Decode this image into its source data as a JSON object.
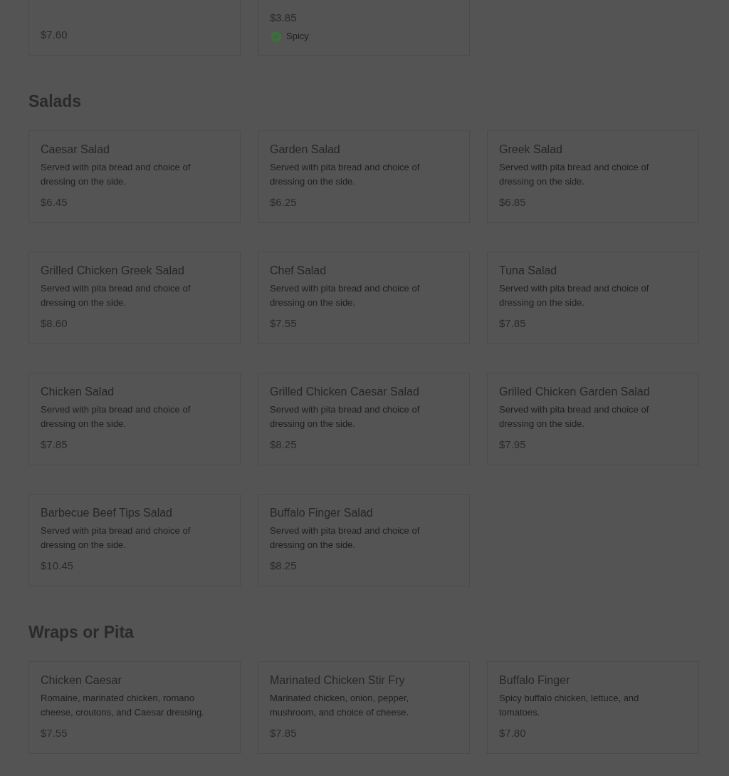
{
  "sections": [
    {
      "items": [
        {
          "price": "$7.60"
        },
        {
          "price": "$3.85",
          "tags": [
            "Spicy"
          ]
        }
      ]
    },
    {
      "heading": "Salads",
      "items": [
        {
          "name": "Caesar Salad",
          "description": "Served with pita bread and choice of dressing on the side.",
          "price": "$6.45"
        },
        {
          "name": "Garden Salad",
          "description": "Served with pita bread and choice of dressing on the side.",
          "price": "$6.25"
        },
        {
          "name": "Greek Salad",
          "description": "Served with pita bread and choice of dressing on the side.",
          "price": "$6.85"
        },
        {
          "name": "Grilled Chicken Greek Salad",
          "description": "Served with pita bread and choice of dressing on the side.",
          "price": "$8.60"
        },
        {
          "name": "Chef Salad",
          "description": "Served with pita bread and choice of dressing on the side.",
          "price": "$7.55"
        },
        {
          "name": "Tuna Salad",
          "description": "Served with pita bread and choice of dressing on the side.",
          "price": "$7.85"
        },
        {
          "name": "Chicken Salad",
          "description": "Served with pita bread and choice of dressing on the side.",
          "price": "$7.85"
        },
        {
          "name": "Grilled Chicken Caesar Salad",
          "description": "Served with pita bread and choice of dressing on the side.",
          "price": "$8.25"
        },
        {
          "name": "Grilled Chicken Garden Salad",
          "description": "Served with pita bread and choice of dressing on the side.",
          "price": "$7.95"
        },
        {
          "name": "Barbecue Beef Tips Salad",
          "description": "Served with pita bread and choice of dressing on the side.",
          "price": "$10.45"
        },
        {
          "name": "Buffalo Finger Salad",
          "description": "Served with pita bread and choice of dressing on the side.",
          "price": "$8.25"
        }
      ]
    },
    {
      "heading": "Wraps or Pita",
      "items": [
        {
          "name": "Chicken Caesar",
          "description": "Romaine, marinated chicken, romano cheese, croutons, and Caesar dressing.",
          "price": "$7.55"
        },
        {
          "name": "Marinated Chicken Stir Fry",
          "description": "Marinated chicken, onion, pepper, mushroom, and choice of cheese.",
          "price": "$7.85"
        },
        {
          "name": "Buffalo Finger",
          "description": "Spicy buffalo chicken, lettuce, and tomatoes.",
          "price": "$7.80"
        }
      ]
    }
  ]
}
